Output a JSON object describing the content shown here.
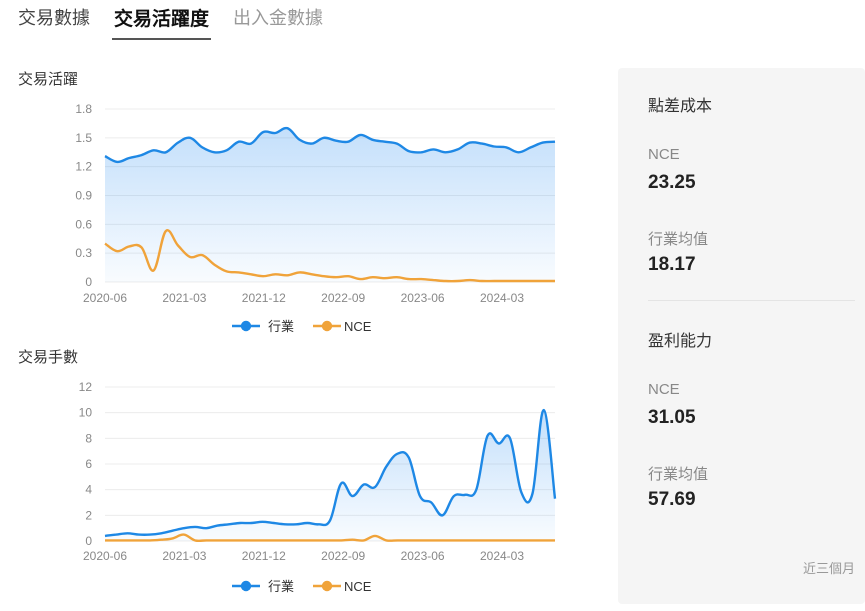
{
  "tabs": [
    {
      "label": "交易數據"
    },
    {
      "label": "交易活躍度"
    },
    {
      "label": "出入金數據"
    }
  ],
  "chart_data": [
    {
      "type": "area",
      "title": "交易活躍",
      "x_ticks": [
        "2020-06",
        "2021-03",
        "2021-12",
        "2022-09",
        "2023-06",
        "2024-03"
      ],
      "y_ticks": [
        "0",
        "0.3",
        "0.6",
        "0.9",
        "1.2",
        "1.5",
        "1.8"
      ],
      "ylim": [
        0,
        1.8
      ],
      "legend": [
        "行業",
        "NCE"
      ],
      "legend_position": "bottom",
      "series": [
        {
          "name": "行業",
          "color": "#1e88e5",
          "values": [
            1.31,
            1.25,
            1.29,
            1.32,
            1.37,
            1.35,
            1.45,
            1.5,
            1.4,
            1.35,
            1.37,
            1.46,
            1.44,
            1.56,
            1.55,
            1.6,
            1.48,
            1.44,
            1.5,
            1.47,
            1.46,
            1.53,
            1.48,
            1.46,
            1.44,
            1.36,
            1.35,
            1.38,
            1.35,
            1.38,
            1.45,
            1.44,
            1.41,
            1.4,
            1.35,
            1.4,
            1.45,
            1.46
          ]
        },
        {
          "name": "NCE",
          "color": "#f0a33a",
          "values": [
            0.4,
            0.32,
            0.37,
            0.36,
            0.12,
            0.53,
            0.38,
            0.26,
            0.28,
            0.18,
            0.11,
            0.1,
            0.08,
            0.06,
            0.08,
            0.07,
            0.1,
            0.08,
            0.06,
            0.05,
            0.06,
            0.03,
            0.05,
            0.04,
            0.05,
            0.03,
            0.03,
            0.02,
            0.01,
            0.01,
            0.02,
            0.01,
            0.01,
            0.01,
            0.01,
            0.01,
            0.01,
            0.01
          ]
        }
      ]
    },
    {
      "type": "area",
      "title": "交易手數",
      "x_ticks": [
        "2020-06",
        "2021-03",
        "2021-12",
        "2022-09",
        "2023-06",
        "2024-03"
      ],
      "y_ticks": [
        "0",
        "2",
        "4",
        "6",
        "8",
        "10",
        "12"
      ],
      "ylim": [
        0,
        12
      ],
      "legend": [
        "行業",
        "NCE"
      ],
      "legend_position": "bottom",
      "series": [
        {
          "name": "行業",
          "color": "#1e88e5",
          "values": [
            0.4,
            0.5,
            0.6,
            0.5,
            0.5,
            0.6,
            0.8,
            1.0,
            1.1,
            1.0,
            1.2,
            1.3,
            1.4,
            1.4,
            1.5,
            1.4,
            1.3,
            1.3,
            1.4,
            1.3,
            1.6,
            4.5,
            3.5,
            4.4,
            4.2,
            5.8,
            6.8,
            6.5,
            3.5,
            3.0,
            2.0,
            3.5,
            3.6,
            4.0,
            8.2,
            7.6,
            8.0,
            3.8,
            3.7,
            10.2,
            3.3
          ]
        },
        {
          "name": "NCE",
          "color": "#f0a33a",
          "values": [
            0.05,
            0.05,
            0.05,
            0.05,
            0.05,
            0.1,
            0.2,
            0.5,
            0.05,
            0.05,
            0.05,
            0.05,
            0.05,
            0.05,
            0.05,
            0.05,
            0.05,
            0.05,
            0.05,
            0.05,
            0.05,
            0.05,
            0.1,
            0.05,
            0.4,
            0.05,
            0.05,
            0.05,
            0.05,
            0.05,
            0.05,
            0.05,
            0.05,
            0.05,
            0.05,
            0.05,
            0.05,
            0.05,
            0.05,
            0.05,
            0.05
          ]
        }
      ]
    }
  ],
  "panel": {
    "spread_title": "點差成本",
    "spread_nce_label": "NCE",
    "spread_nce_value": "23.25",
    "spread_avg_label": "行業均值",
    "spread_avg_value": "18.17",
    "profit_title": "盈利能力",
    "profit_nce_label": "NCE",
    "profit_nce_value": "31.05",
    "profit_avg_label": "行業均值",
    "profit_avg_value": "57.69",
    "note": "近三個月"
  }
}
